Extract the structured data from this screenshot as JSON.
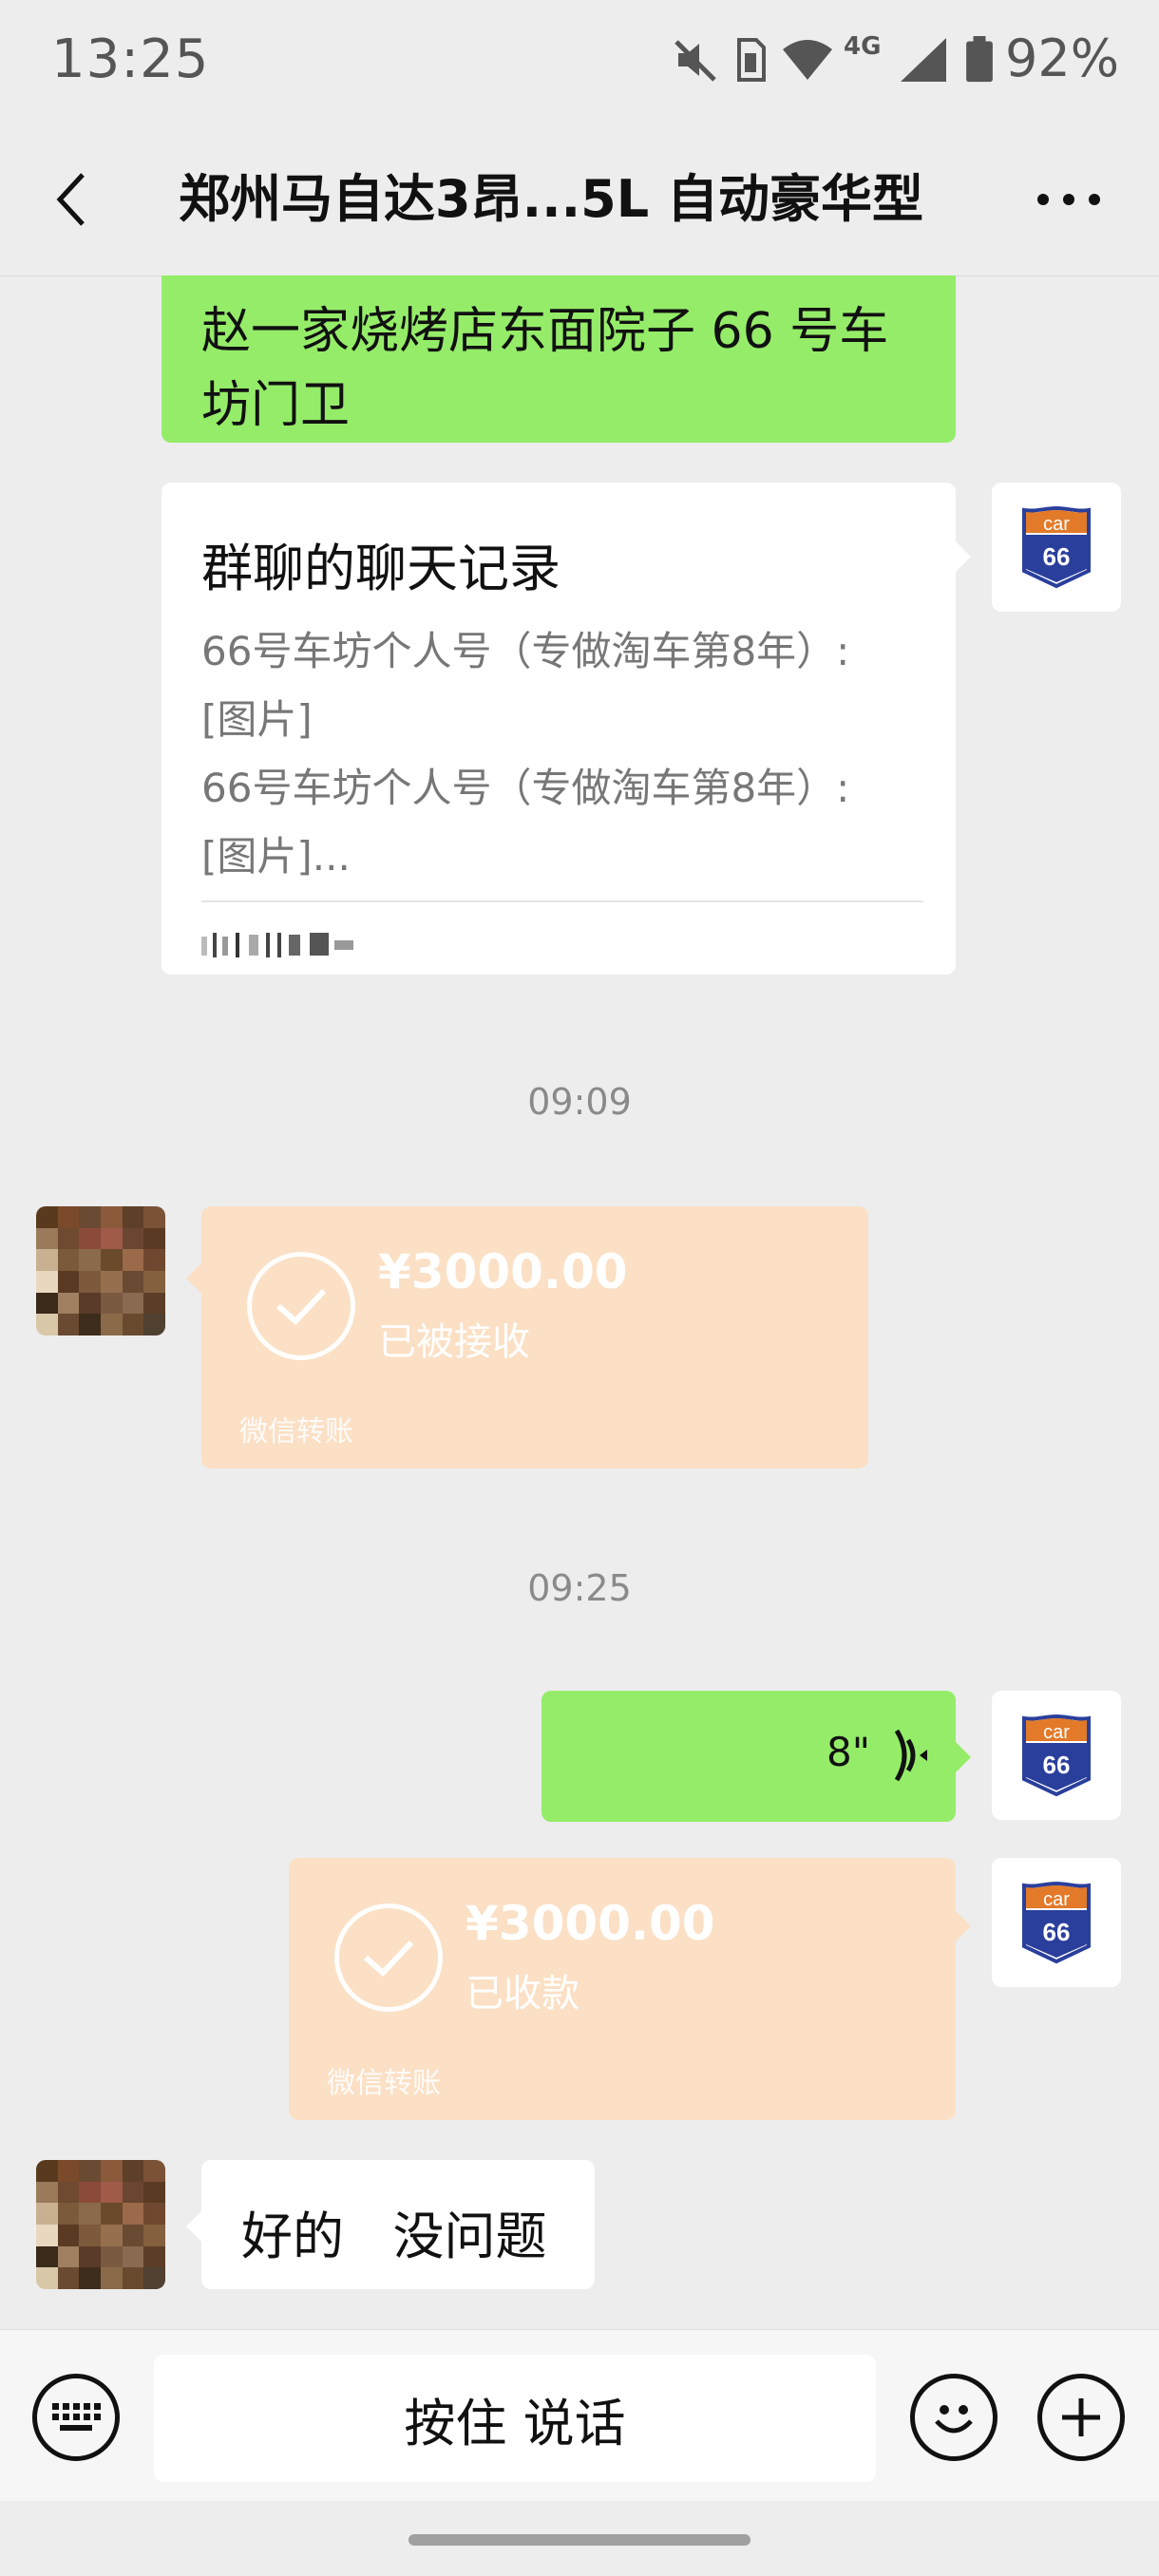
{
  "status_bar": {
    "time": "13:25",
    "network": "4G",
    "battery": "92%",
    "icons": [
      "mute-icon",
      "sim-icon",
      "wifi-icon",
      "signal-icon",
      "battery-icon"
    ]
  },
  "header": {
    "title": "郑州马自达3昂...5L 自动豪华型",
    "back_icon": "chevron-left-icon",
    "more_icon": "more-dots-icon"
  },
  "messages": {
    "m1": {
      "text": "赵一家烧烤店东面院子 66 号车坊门卫"
    },
    "m2": {
      "title": "群聊的聊天记录",
      "lines": [
        "66号车坊个人号（专做淘车第8年）:",
        "[图片]",
        "66号车坊个人号（专做淘车第8年）:",
        "[图片]..."
      ]
    },
    "ts1": "09:09",
    "m3": {
      "amount": "¥3000.00",
      "status": "已被接收",
      "footer": "微信转账"
    },
    "ts2": "09:25",
    "m4": {
      "duration": "8\""
    },
    "m5": {
      "amount": "¥3000.00",
      "status": "已收款",
      "footer": "微信转账"
    },
    "m6": {
      "text": "好的   没问题"
    }
  },
  "avatar_66": {
    "top": "car",
    "bottom": "66"
  },
  "input_bar": {
    "hold_to_talk": "按住 说话",
    "icons": [
      "keyboard-icon",
      "emoji-icon",
      "plus-icon"
    ]
  },
  "colors": {
    "background": "#ededed",
    "green_bubble": "#95ec69",
    "transfer_bubble": "#fbe0c5",
    "avatar_shield_orange": "#e27a2a",
    "avatar_shield_blue": "#2a3f9c"
  }
}
